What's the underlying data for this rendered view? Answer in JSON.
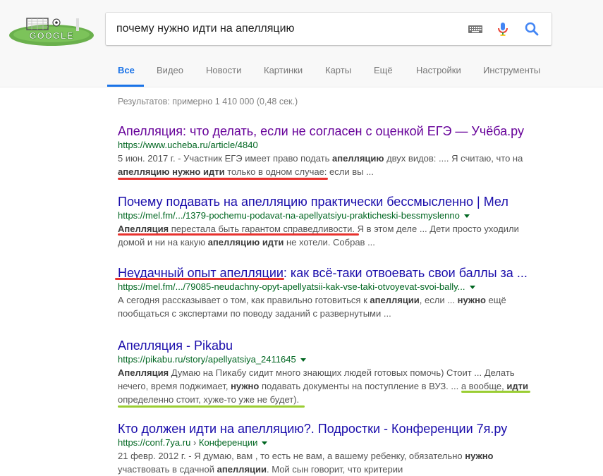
{
  "colors": {
    "link": "#1a0dab",
    "visited": "#660099",
    "url": "#006621",
    "snippet": "#545454",
    "accent": "#1a73e8",
    "underline_red": "#e8322e",
    "underline_green": "#9acd32"
  },
  "logo": {
    "text": "GOOGLE"
  },
  "search": {
    "query": "почему нужно идти на апелляцию"
  },
  "icons": {
    "keyboard": "keyboard-icon",
    "mic": "mic-icon",
    "search": "search-icon"
  },
  "tabs": [
    {
      "label": "Все",
      "active": true
    },
    {
      "label": "Видео"
    },
    {
      "label": "Новости"
    },
    {
      "label": "Картинки"
    },
    {
      "label": "Карты"
    },
    {
      "label": "Ещё"
    },
    {
      "label": "Настройки"
    },
    {
      "label": "Инструменты"
    }
  ],
  "stats": "Результатов: примерно 1 410 000 (0,48 сек.)",
  "results": [
    {
      "title": "Апелляция: что делать, если не согласен с оценкой ЕГЭ — Учёба.ру",
      "url": "https://www.ucheba.ru/article/4840",
      "date": "5 июн. 2017 г. -",
      "s1": " Участник ЕГЭ имеет право подать ",
      "s1b": "апелляцию",
      "s1c": " двух видов: .... Я считаю, что на",
      "s2b": "апелляцию нужно идти",
      "s2c": " только в одном случае: если вы ..."
    },
    {
      "title": "Почему подавать на апелляцию практически бессмысленно | Мел",
      "url": "https://mel.fm/.../1379-pochemu-podavat-na-apellyatsiyu-prakticheski-bessmyslenno",
      "s1b": "Апелляция",
      "s1c": " перестала быть гарантом справедливости. Я в этом деле ... Дети просто уходили",
      "s2": "домой и ни на какую ",
      "s2b": "апелляцию идти",
      "s2c": " не хотели. Собрав ..."
    },
    {
      "title": "Неудачный опыт апелляции: как всё-таки отвоевать свои баллы за ...",
      "url": "https://mel.fm/.../79085-neudachny-opyt-apellyatsii-kak-vse-taki-otvoyevat-svoi-bally...",
      "s1": "А сегодня рассказывает о том, как правильно готовиться к ",
      "s1b": "апелляции",
      "s1c": ", если ... ",
      "s1d": "нужно",
      "s1e": " ещё",
      "s2": "пообщаться с экспертами по поводу заданий с развернутыми ..."
    },
    {
      "title": "Апелляция - Pikabu",
      "url": "https://pikabu.ru/story/apellyatsiya_2411645",
      "s1b": "Апелляция",
      "s1c": " Думаю на Пикабу сидит много знающих людей готовых помочь) Стоит ... Делать",
      "s2": "нечего, время поджимает, ",
      "s2b": "нужно",
      "s2c": " подавать документы на поступление в ВУЗ. ... а вообще, ",
      "s2d": "идти",
      "s3": "определенно стоит, хуже-то уже не будет)."
    },
    {
      "title": "Кто должен идти на апелляцию?. Подростки - Конференции 7я.ру",
      "url": "https://conf.7ya.ru",
      "breadcrumb_sep": " › ",
      "breadcrumb": "Конференции",
      "date": "21 февр. 2012 г. -",
      "s1": " Я думаю, вам , то есть не вам, а вашему ребенку, обязательно ",
      "s1b": "нужно",
      "s2": "участвовать в сдачной ",
      "s2b": "апелляции",
      "s2c": ". Мой сын говорит, что критерии"
    }
  ]
}
